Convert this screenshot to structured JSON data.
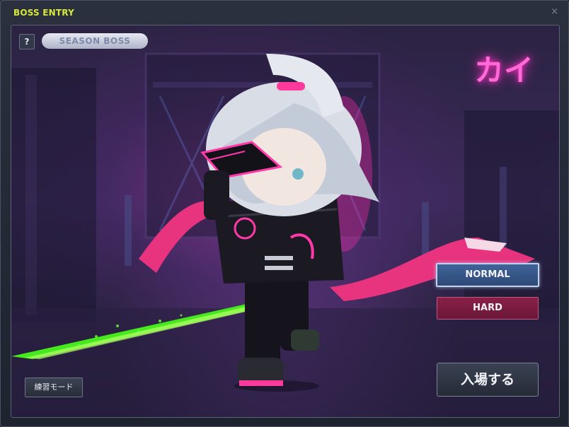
{
  "window": {
    "title": "BOSS ENTRY",
    "close_label": "×"
  },
  "panel": {
    "help_label": "?",
    "season_badge": "SEASON BOSS",
    "boss_name": "カイ"
  },
  "difficulty": {
    "normal_label": "NORMAL",
    "hard_label": "HARD",
    "selected": "NORMAL"
  },
  "actions": {
    "enter_label": "入場する",
    "practice_label": "練習モード"
  },
  "colors": {
    "title": "#d6e83a",
    "accent_pink": "#ff6ad8",
    "normal_btn": "#3f6399",
    "hard_btn": "#8a2047"
  },
  "icons": {
    "help": "question-icon",
    "close": "close-icon"
  }
}
